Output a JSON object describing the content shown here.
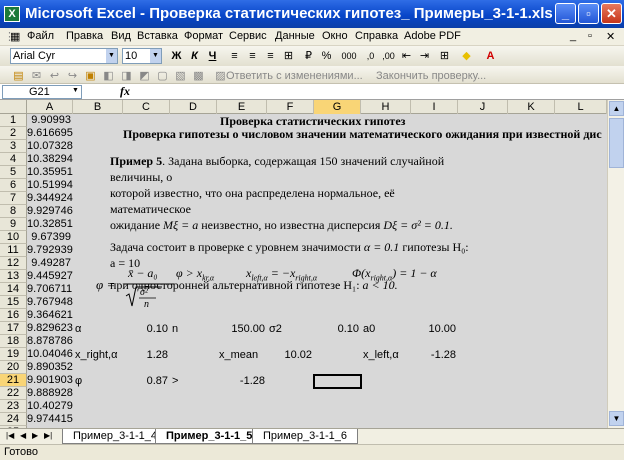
{
  "window": {
    "title": "Microsoft Excel - Проверка статистических гипотез_ Примеры_3-1-1.xls"
  },
  "menu": [
    "Файл",
    "Правка",
    "Вид",
    "Вставка",
    "Формат",
    "Сервис",
    "Данные",
    "Окно",
    "Справка",
    "Adobe PDF"
  ],
  "format_toolbar": {
    "font": "Arial Cyr",
    "size": "10",
    "bold": "Ж",
    "italic": "К",
    "underline": "Ч",
    "percent": "%",
    "thousands": "000"
  },
  "review_toolbar": {
    "reply": "Ответить с изменениями...",
    "end_review": "Закончить проверку..."
  },
  "formula_bar": {
    "name_box": "G21",
    "fx": "fx",
    "content": ""
  },
  "columns": [
    "A",
    "B",
    "C",
    "D",
    "E",
    "F",
    "G",
    "H",
    "I",
    "J",
    "K",
    "L"
  ],
  "selected_column": "G",
  "rows": [
    "1",
    "2",
    "3",
    "4",
    "5",
    "6",
    "7",
    "8",
    "9",
    "10",
    "11",
    "12",
    "13",
    "14",
    "15",
    "16",
    "17",
    "18",
    "19",
    "20",
    "21",
    "22",
    "23",
    "24",
    "25"
  ],
  "selected_row": "21",
  "col_a_values": [
    "9.90993",
    "9.616695",
    "10.07328",
    "10.38294",
    "10.35951",
    "10.51994",
    "9.344924",
    "9.929746",
    "10.32851",
    "9.67399",
    "9.792939",
    "9.49287",
    "9.445927",
    "9.706711",
    "9.767948",
    "9.364621",
    "9.829623",
    "8.878786",
    "10.04046",
    "9.890352",
    "9.901903",
    "9.888928",
    "10.40279",
    "9.974415",
    ""
  ],
  "heading1": "Проверка статистических гипотез",
  "heading2": "Проверка гипотезы о числовом значении математического ожидания при известной дис",
  "example": {
    "label": "Пример 5",
    "line1": ". Задана выборка, содержащая 150 значений случайной величины, о",
    "line2": "которой известно, что она распределена нормальное, её математическое",
    "line3a": "ожидание ",
    "line3b": "Mξ = a",
    "line3c": " неизвестно, но  известна дисперсия ",
    "line3d": "Dξ = σ² = 0.1.",
    "line4a": "Задача состоит в проверке с уровнем значимости ",
    "line4b": "α = 0.1",
    "line4c": " гипотезы  H₀: a = 10",
    "line5a": "при односторонней альтернативной гипотезе H₁: ",
    "line5b": "a < 10."
  },
  "formulas": {
    "phi": "φ = (x̄ − a₀) / √(σ²/n)",
    "crit": "φ > x_kr,α",
    "xleft": "x_left,α = −x_right,α",
    "Phi": "Φ(x_right,α) = 1 − α"
  },
  "params": {
    "row17": {
      "b": "α",
      "c": "0.10",
      "d": "n",
      "e": "150.00",
      "f": "σ2",
      "g": "0.10",
      "h": "a0",
      "i": "10.00"
    },
    "row19": {
      "b": "x_right,α",
      "c": "1.28",
      "e": "x_mean",
      "f": "10.02",
      "h": "x_left,α",
      "i": "-1.28"
    },
    "row21": {
      "b": "φ",
      "c": "0.87",
      "d": ">",
      "e": "-1.28"
    }
  },
  "sheets": [
    "Пример_3-1-1_4",
    "Пример_3-1-1_5",
    "Пример_3-1-1_6"
  ],
  "active_sheet": "Пример_3-1-1_5",
  "status": "Готово"
}
